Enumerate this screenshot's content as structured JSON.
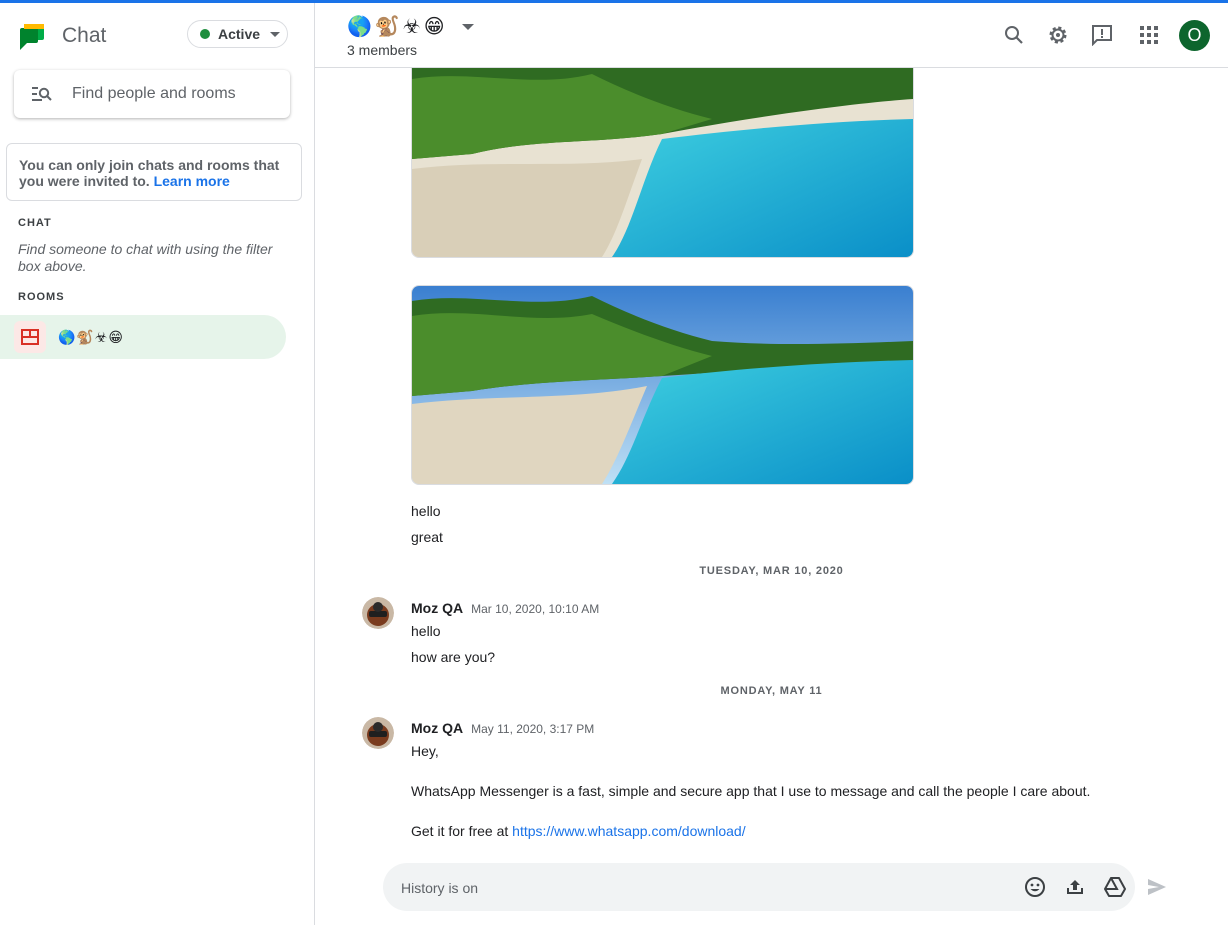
{
  "app": {
    "title": "Chat"
  },
  "status": {
    "label": "Active",
    "color": "#1e8e3e"
  },
  "search": {
    "placeholder": "Find people and rooms"
  },
  "notice": {
    "text": "You can only join chats and rooms that you were invited to.",
    "link": "Learn more"
  },
  "sections": {
    "chat": {
      "title": "CHAT",
      "empty_text": "Find someone to chat with using the filter box above."
    },
    "rooms": {
      "title": "ROOMS",
      "items": [
        {
          "name": "🌎🐒☣😁"
        }
      ]
    }
  },
  "header": {
    "room_name": "🌎🐒☣😁",
    "members": "3 members",
    "user_initial": "O"
  },
  "messages": {
    "pre_texts": [
      "hello",
      "great"
    ],
    "groups": [
      {
        "date": "TUESDAY, MAR 10, 2020",
        "sender": "Moz QA",
        "time": "Mar 10, 2020, 10:10 AM",
        "lines": [
          "hello",
          "how are you?"
        ]
      },
      {
        "date": "MONDAY, MAY 11",
        "sender": "Moz QA",
        "time": "May 11, 2020, 3:17 PM",
        "lines": [
          "Hey,",
          "WhatsApp Messenger is a fast, simple and secure app that I use to message and call the people I care about."
        ],
        "link_prefix": "Get it for free at ",
        "link": "https://www.whatsapp.com/download/"
      }
    ]
  },
  "composer": {
    "placeholder": "History is on"
  },
  "colors": {
    "accent": "#1a73e8",
    "selected_room": "#e6f4ea",
    "user_avatar": "#0d652d"
  }
}
